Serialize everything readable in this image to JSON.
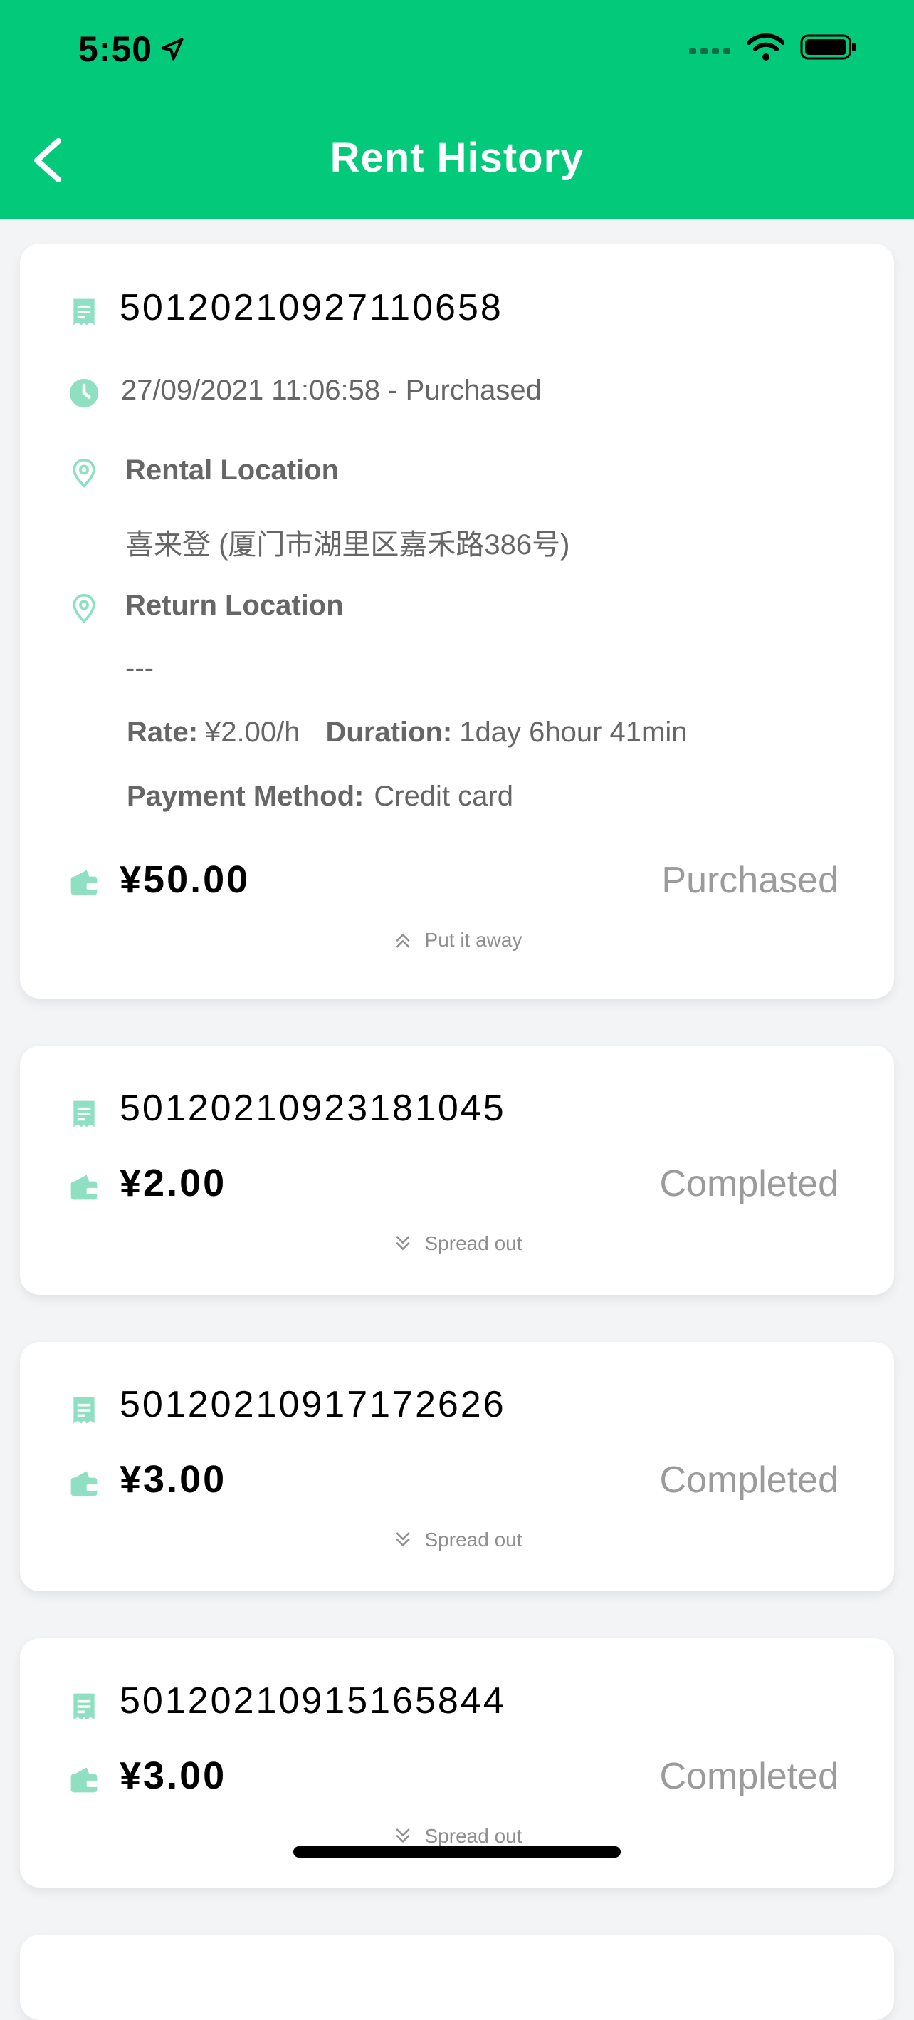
{
  "status_bar": {
    "time": "5:50"
  },
  "header": {
    "title": "Rent History"
  },
  "colors": {
    "brand": "#03c97b",
    "icon_tint": "#8fe0c3",
    "card_bg": "#ffffff",
    "page_bg": "#f3f4f6"
  },
  "orders": [
    {
      "order_no": "50120210927110658",
      "datetime": "27/09/2021 11:06:58 - Purchased",
      "rental_location_label": "Rental Location",
      "rental_location": "喜来登 (厦门市湖里区嘉禾路386号)",
      "return_location_label": "Return Location",
      "return_location": "---",
      "rate_label": "Rate:",
      "rate": "¥2.00/h",
      "duration_label": "Duration:",
      "duration": "1day 6hour 41min",
      "payment_label": "Payment Method:",
      "payment": "Credit card",
      "price": "¥50.00",
      "status": "Purchased",
      "toggle": "Put it away"
    },
    {
      "order_no": "50120210923181045",
      "price": "¥2.00",
      "status": "Completed",
      "toggle": "Spread out"
    },
    {
      "order_no": "50120210917172626",
      "price": "¥3.00",
      "status": "Completed",
      "toggle": "Spread out"
    },
    {
      "order_no": "50120210915165844",
      "price": "¥3.00",
      "status": "Completed",
      "toggle": "Spread out"
    }
  ]
}
